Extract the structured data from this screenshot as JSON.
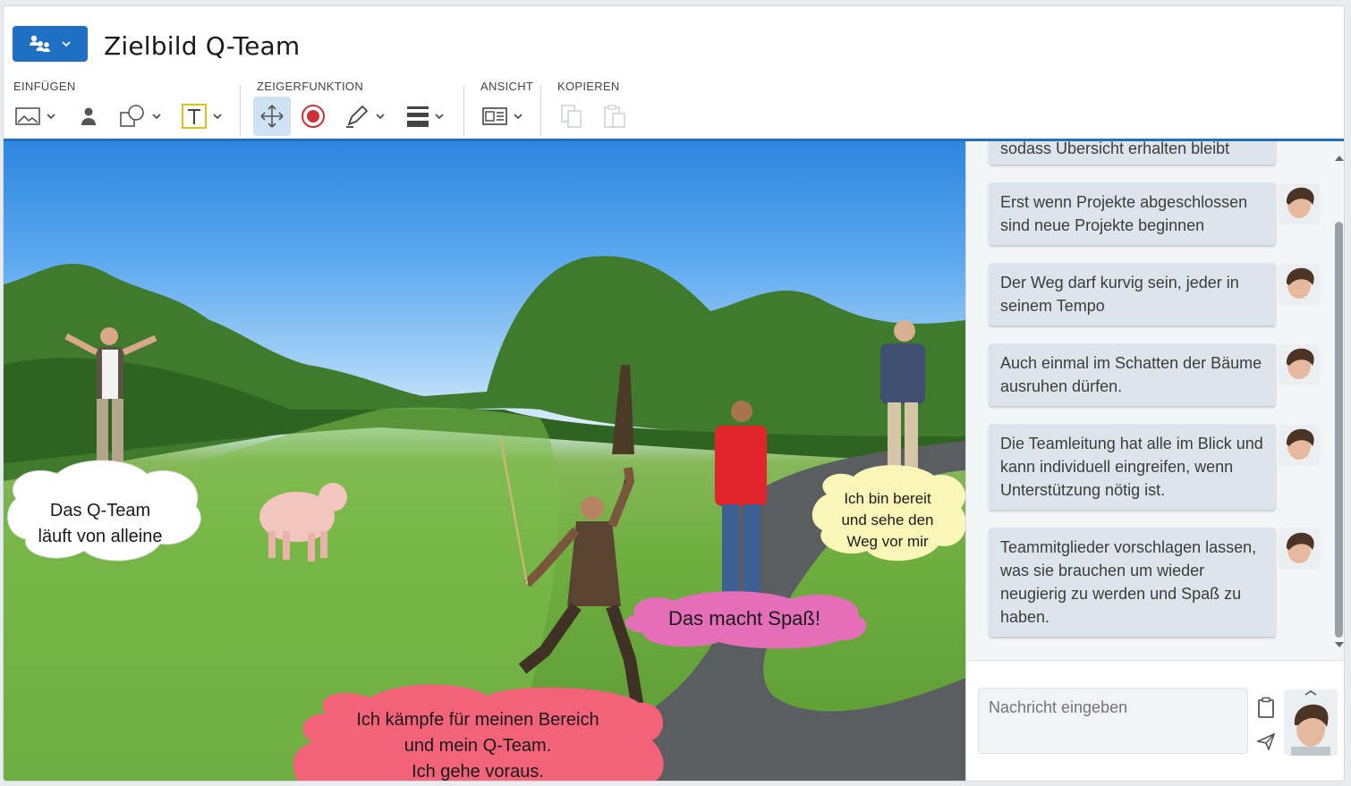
{
  "header": {
    "title": "Zielbild Q-Team",
    "menu_icon": "users-hierarchy-icon"
  },
  "toolbar": {
    "groups": {
      "insert": "EINFÜGEN",
      "pointer": "ZEIGERFUNKTION",
      "view": "ANSICHT",
      "copy": "KOPIEREN"
    },
    "accent_color": "#1f6fc4"
  },
  "canvas": {
    "bubbles": {
      "b1": [
        "Das Q-Team",
        "läuft von alleine"
      ],
      "b2": [
        "Ich bin bereit",
        "und sehe den",
        "Weg vor mir"
      ],
      "b3": [
        "Das macht Spaß!"
      ],
      "b4": [
        "Ich kämpfe für meinen Bereich",
        "und mein Q-Team.",
        "Ich gehe voraus."
      ]
    },
    "bubble_colors": {
      "b1": "#ffffff",
      "b2": "#faf6b8",
      "b3": "#e46fb8",
      "b4": "#f2637a"
    }
  },
  "chat": {
    "messages": [
      "sodass Übersicht erhalten bleibt",
      "Erst wenn Projekte abgeschlossen sind neue Projekte beginnen",
      "Der Weg darf kurvig sein, jeder in seinem Tempo",
      "Auch einmal im Schatten der Bäume ausruhen dürfen.",
      "Die Teamleitung hat alle im Blick und kann individuell eingreifen, wenn Unterstützung nötig ist.",
      "Teammitglieder vorschlagen lassen, was sie brauchen um wieder neugierig zu werden und Spaß zu haben."
    ],
    "input_placeholder": "Nachricht eingeben"
  }
}
